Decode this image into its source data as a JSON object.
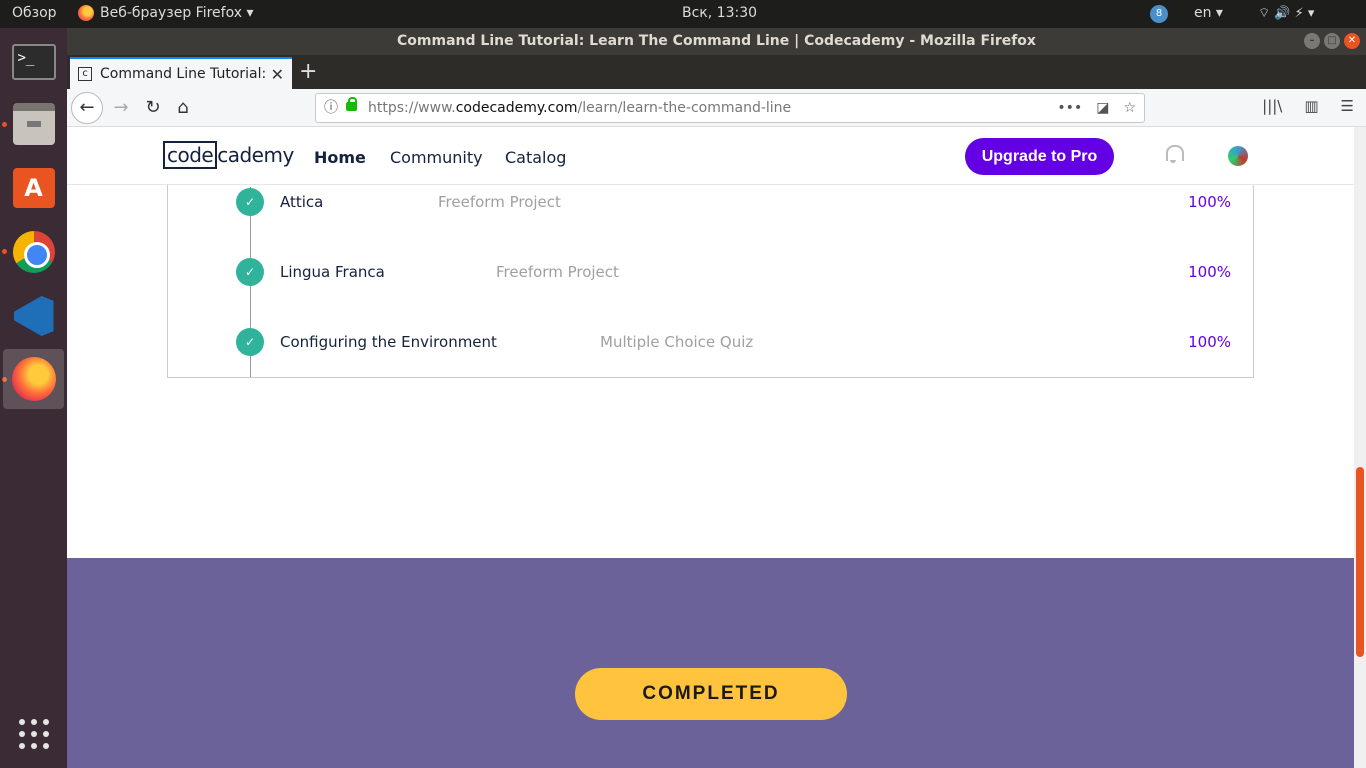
{
  "top_panel": {
    "activities": "Обзор",
    "app_menu": "Веб-браузер Firefox ▾",
    "clock": "Вск, 13:30",
    "notification_count": "8",
    "language": "en ▾",
    "system_icons": "⌔ 🔊 ⚡ ▾"
  },
  "window": {
    "title": "Command Line Tutorial: Learn The Command Line | Codecademy - Mozilla Firefox",
    "controls": {
      "minimize": "–",
      "maximize": "□",
      "close": "✕"
    }
  },
  "tab": {
    "title": "Command Line Tutorial: Le",
    "favicon": "c",
    "close": "✕",
    "new_tab": "+"
  },
  "navbar": {
    "back": "←",
    "forward": "→",
    "reload": "↻",
    "home": "⌂",
    "url_info": "ⓘ",
    "url_scheme": "https://www.",
    "url_host": "codecademy.com",
    "url_path": "/learn/learn-the-command-line",
    "url_more": "•••",
    "url_pocket": "◪",
    "url_bookmark": "☆",
    "library": "|||\\",
    "sidebar": "▥",
    "menu": "☰"
  },
  "site_header": {
    "logo_box": "code",
    "logo_rest": "cademy",
    "nav_home": "Home",
    "nav_community": "Community",
    "nav_catalog": "Catalog",
    "upgrade_button": "Upgrade to Pro"
  },
  "progress_items": [
    {
      "name": "Attica",
      "type": "Freeform Project",
      "percent": "100%"
    },
    {
      "name": "Lingua Franca",
      "type": "Freeform Project",
      "percent": "100%"
    },
    {
      "name": "Configuring the Environment",
      "type": "Multiple Choice Quiz",
      "percent": "100%"
    }
  ],
  "check_glyph": "✓",
  "completed_button": "COMPLETED",
  "dock": {
    "terminal_glyph": ">_",
    "store_glyph": "A"
  },
  "colors": {
    "accent": "#6400e4",
    "check": "#2fb39a",
    "band": "#6b6299",
    "completed": "#ffc33d"
  }
}
